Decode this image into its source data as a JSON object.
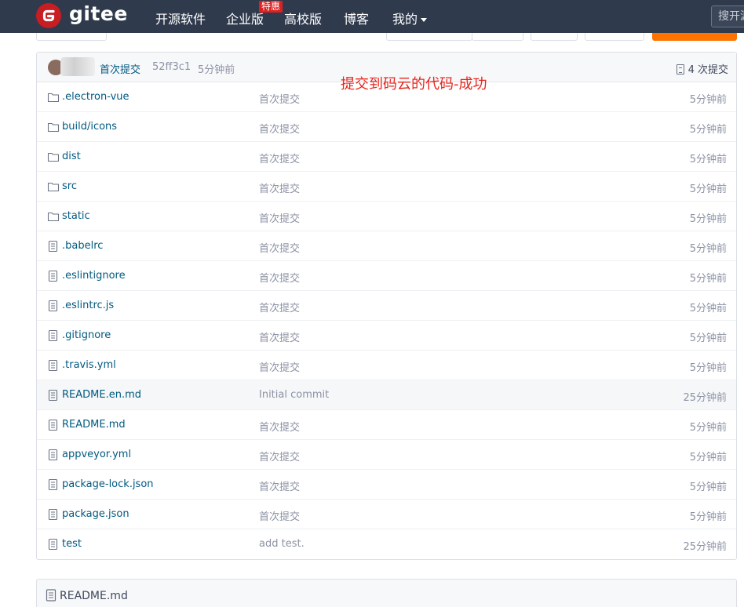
{
  "navbar": {
    "brand": "gitee",
    "items": [
      {
        "label": "开源软件"
      },
      {
        "label": "企业版"
      },
      {
        "label": "高校版"
      },
      {
        "label": "博客"
      },
      {
        "label": "我的"
      }
    ],
    "badge": "特惠",
    "search_placeholder": "搜开源"
  },
  "latest_commit": {
    "message": "首次提交",
    "hash": "52ff3c1",
    "time": "5分钟前",
    "count_label": "4 次提交"
  },
  "annotation": "提交到码云的代码-成功",
  "files": [
    {
      "name": ".electron-vue",
      "type": "folder",
      "message": "首次提交",
      "time": "5分钟前"
    },
    {
      "name": "build/icons",
      "type": "folder",
      "message": "首次提交",
      "time": "5分钟前"
    },
    {
      "name": "dist",
      "type": "folder",
      "message": "首次提交",
      "time": "5分钟前"
    },
    {
      "name": "src",
      "type": "folder",
      "message": "首次提交",
      "time": "5分钟前"
    },
    {
      "name": "static",
      "type": "folder",
      "message": "首次提交",
      "time": "5分钟前"
    },
    {
      "name": ".babelrc",
      "type": "file",
      "message": "首次提交",
      "time": "5分钟前"
    },
    {
      "name": ".eslintignore",
      "type": "file",
      "message": "首次提交",
      "time": "5分钟前"
    },
    {
      "name": ".eslintrc.js",
      "type": "file",
      "message": "首次提交",
      "time": "5分钟前"
    },
    {
      "name": ".gitignore",
      "type": "file",
      "message": "首次提交",
      "time": "5分钟前"
    },
    {
      "name": ".travis.yml",
      "type": "file",
      "message": "首次提交",
      "time": "5分钟前"
    },
    {
      "name": "README.en.md",
      "type": "file",
      "message": "Initial commit",
      "time": "25分钟前",
      "highlighted": true
    },
    {
      "name": "README.md",
      "type": "file",
      "message": "首次提交",
      "time": "5分钟前"
    },
    {
      "name": "appveyor.yml",
      "type": "file",
      "message": "首次提交",
      "time": "5分钟前"
    },
    {
      "name": "package-lock.json",
      "type": "file",
      "message": "首次提交",
      "time": "5分钟前"
    },
    {
      "name": "package.json",
      "type": "file",
      "message": "首次提交",
      "time": "5分钟前"
    },
    {
      "name": "test",
      "type": "file",
      "message": "add test.",
      "time": "25分钟前"
    }
  ],
  "readme": {
    "title": "README.md"
  }
}
